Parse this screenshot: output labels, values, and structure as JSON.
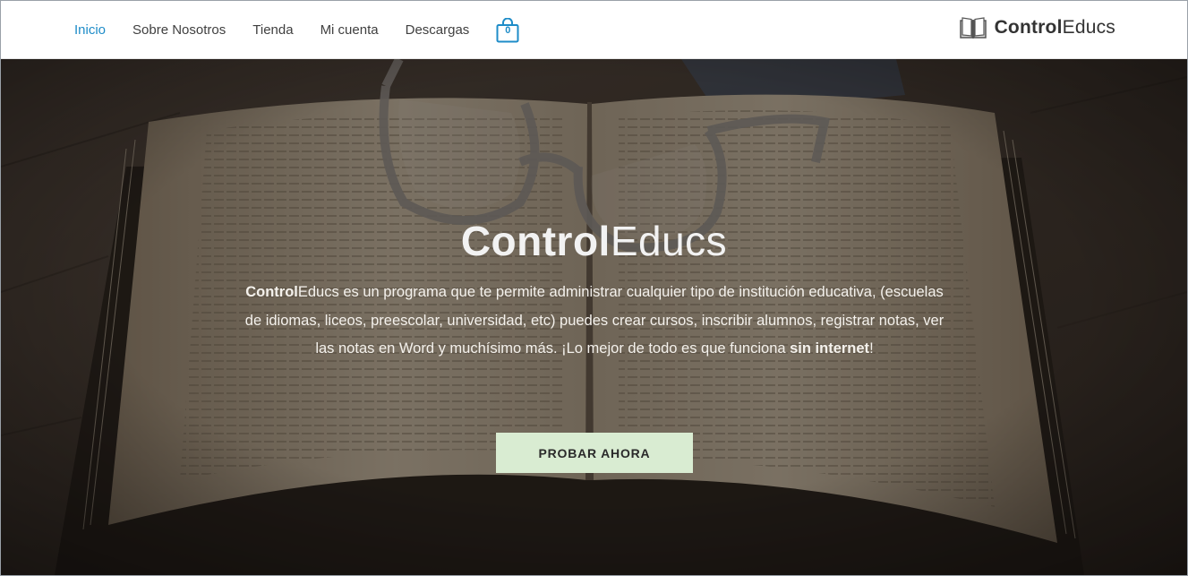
{
  "nav": {
    "items": [
      {
        "label": "Inicio",
        "active": true
      },
      {
        "label": "Sobre Nosotros",
        "active": false
      },
      {
        "label": "Tienda",
        "active": false
      },
      {
        "label": "Mi cuenta",
        "active": false
      },
      {
        "label": "Descargas",
        "active": false
      }
    ],
    "cart": {
      "icon": "shopping-bag-icon",
      "count": "0"
    }
  },
  "brand": {
    "icon": "open-book-icon",
    "name_bold": "Control",
    "name_light": "Educs"
  },
  "hero": {
    "background": "open-book-with-glasses-photo",
    "title_bold": "Control",
    "title_light": "Educs",
    "desc_bold_start": "Control",
    "desc_text": "Educs es un programa que te permite administrar cualquier tipo de institución educativa, (escuelas de idiomas, liceos, preescolar, universidad, etc) puedes crear cursos, inscribir alumnos, registrar notas,  ver las notas en Word y muchísimo más. ¡Lo mejor de todo es que funciona ",
    "desc_bold_end": "sin internet",
    "desc_tail": "!",
    "cta_label": "PROBAR AHORA"
  },
  "colors": {
    "accent": "#1e8cc8",
    "cta_bg": "#d9ecd2",
    "nav_text": "#404040"
  }
}
